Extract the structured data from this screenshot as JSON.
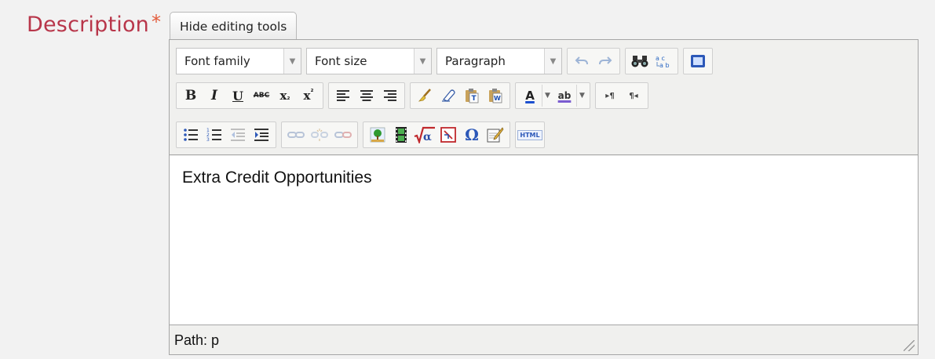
{
  "field": {
    "label": "Description",
    "required_mark": "*"
  },
  "editor_toggle": {
    "label": "Hide editing tools"
  },
  "toolbar": {
    "font_family": "Font family",
    "font_size": "Font size",
    "format": "Paragraph",
    "buttons_row1": [
      "undo-icon",
      "redo-icon",
      "search-replace-icon",
      "spellcheck-icon",
      "fullscreen-icon"
    ],
    "buttons_row2": {
      "bold": "B",
      "italic": "I",
      "underline": "U",
      "strikethrough": "ABC",
      "subscript_base": "x",
      "subscript_mark": "₂",
      "superscript_base": "x",
      "superscript_mark": "²",
      "font_color_letter": "A",
      "highlight_letters": "ab",
      "ltr": "▸¶",
      "rtl": "¶◂"
    },
    "buttons_row3": {
      "html": "HTML",
      "omega": "Ω"
    }
  },
  "content": {
    "text": "Extra Credit Opportunities"
  },
  "statusbar": {
    "path": "Path: p"
  },
  "colors": {
    "label": "#b8364a",
    "required": "#e35c3c",
    "border": "#a6a6a6",
    "toolbar_bg": "#f0f0ee",
    "font_color_underline": "#1c4fcf",
    "highlight_underline": "#7a5cd0"
  }
}
